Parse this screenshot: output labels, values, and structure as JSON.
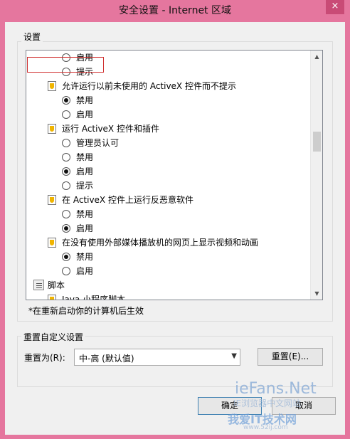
{
  "window": {
    "title": "安全设置 - Internet 区域",
    "close_label": "×"
  },
  "settings_group": {
    "title": "设置",
    "tree": [
      {
        "kind": "radio",
        "label": "启用",
        "checked": false
      },
      {
        "kind": "radio",
        "label": "提示",
        "checked": false
      },
      {
        "kind": "item",
        "label": "允许运行以前未使用的 ActiveX 控件而不提示",
        "icon": "shield-icon"
      },
      {
        "kind": "radio",
        "label": "禁用",
        "checked": true
      },
      {
        "kind": "radio",
        "label": "启用",
        "checked": false
      },
      {
        "kind": "item",
        "label": "运行 ActiveX 控件和插件",
        "icon": "shield-icon"
      },
      {
        "kind": "radio",
        "label": "管理员认可",
        "checked": false
      },
      {
        "kind": "radio",
        "label": "禁用",
        "checked": false
      },
      {
        "kind": "radio",
        "label": "启用",
        "checked": true
      },
      {
        "kind": "radio",
        "label": "提示",
        "checked": false
      },
      {
        "kind": "item",
        "label": "在 ActiveX 控件上运行反恶意软件",
        "icon": "shield-icon"
      },
      {
        "kind": "radio",
        "label": "禁用",
        "checked": false
      },
      {
        "kind": "radio",
        "label": "启用",
        "checked": true
      },
      {
        "kind": "item",
        "label": "在没有使用外部媒体播放机的网页上显示视频和动画",
        "icon": "shield-icon"
      },
      {
        "kind": "radio",
        "label": "禁用",
        "checked": true
      },
      {
        "kind": "radio",
        "label": "启用",
        "checked": false
      },
      {
        "kind": "category",
        "label": "脚本",
        "icon": "script-icon"
      },
      {
        "kind": "item",
        "label": "Java 小程序脚本",
        "icon": "shield-icon"
      }
    ],
    "note": "*在重新启动你的计算机后生效"
  },
  "reset_group": {
    "title": "重置自定义设置",
    "reset_to_label": "重置为(R):",
    "reset_to_value": "中-高 (默认值)",
    "reset_button": "重置(E)..."
  },
  "footer": {
    "ok_button": "确定",
    "cancel_button": "取消"
  },
  "watermark": {
    "line1": "ieFans.Net",
    "line2": "IE浏览器中文网站",
    "line3": "我爱IT技术网",
    "line4": "www.52ij.com"
  }
}
